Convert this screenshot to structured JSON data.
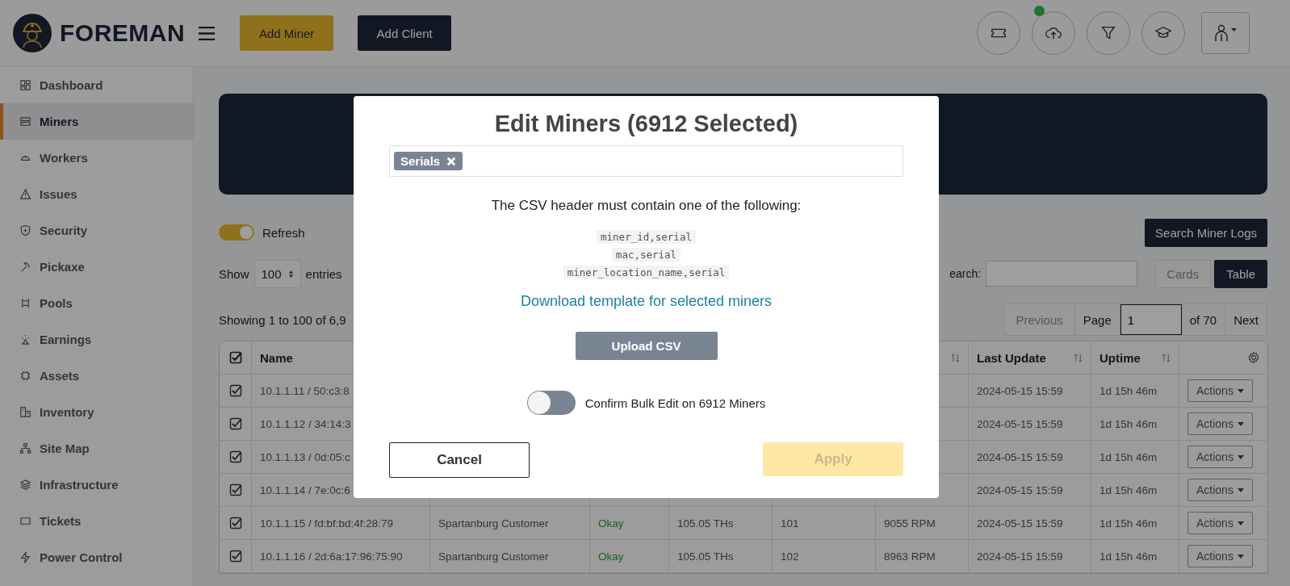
{
  "header": {
    "logo_text": "FOREMAN",
    "buttons": [
      {
        "label": "Add Miner",
        "kind": "accent"
      },
      {
        "label": "Add Client",
        "kind": "dark"
      }
    ],
    "notification": true
  },
  "sidebar": {
    "items": [
      {
        "label": "Dashboard",
        "selected": false
      },
      {
        "label": "Miners",
        "selected": true
      },
      {
        "label": "Workers",
        "selected": false
      },
      {
        "label": "Issues",
        "selected": false
      },
      {
        "label": "Security",
        "selected": false
      },
      {
        "label": "Pickaxe",
        "selected": false
      },
      {
        "label": "Pools",
        "selected": false
      },
      {
        "label": "Earnings",
        "selected": false
      },
      {
        "label": "Assets",
        "selected": false
      },
      {
        "label": "Inventory",
        "selected": false
      },
      {
        "label": "Site Map",
        "selected": false
      },
      {
        "label": "Infrastructure",
        "selected": false
      },
      {
        "label": "Tickets",
        "selected": false
      },
      {
        "label": "Power Control",
        "selected": false
      }
    ]
  },
  "content": {
    "refresh": {
      "label": "Refresh",
      "on": true
    },
    "search_logs_button": "Search Miner Logs",
    "length": {
      "label_before": "Show",
      "value": "100",
      "label_after": "entries"
    },
    "search": {
      "label": "earch:"
    },
    "views": [
      {
        "label": "Cards",
        "selected": false
      },
      {
        "label": "Table",
        "selected": true
      }
    ],
    "info": "Showing 1 to 100 of 6,9",
    "pagination": {
      "previous": "Previous",
      "page_label": "Page",
      "page_value": "1",
      "of": "of 70",
      "next": "Next"
    },
    "table": {
      "all_checked": true,
      "columns": [
        {
          "kind": "text",
          "label": "Name"
        },
        {
          "kind": "text"
        },
        {
          "kind": "status"
        },
        {
          "kind": "text"
        },
        {
          "kind": "text"
        },
        {
          "kind": "text",
          "sortable": true
        },
        {
          "kind": "text",
          "label": "Last Update",
          "sortable": true
        },
        {
          "kind": "text",
          "label": "Uptime",
          "sortable": true
        },
        {
          "kind": "actions"
        }
      ],
      "rows": [
        {
          "checked": true,
          "cells": [
            "10.1.1.11 / 50:c3:8",
            null,
            null,
            null,
            null,
            null,
            "2024-05-15 15:59",
            "1d 15h 46m",
            "Actions"
          ]
        },
        {
          "checked": true,
          "cells": [
            "10.1.1.12 / 34:14:3",
            null,
            null,
            null,
            null,
            null,
            "2024-05-15 15:59",
            "1d 15h 46m",
            "Actions"
          ]
        },
        {
          "checked": true,
          "cells": [
            "10.1.1.13 / 0d:05:c",
            null,
            null,
            null,
            null,
            null,
            "2024-05-15 15:59",
            "1d 15h 46m",
            "Actions"
          ]
        },
        {
          "checked": true,
          "cells": [
            "10.1.1.14 / 7e:0c:6",
            null,
            null,
            null,
            null,
            null,
            "2024-05-15 15:59",
            "1d 15h 46m",
            "Actions"
          ]
        },
        {
          "checked": true,
          "cells": [
            "10.1.1.15 / fd:bf:bd:4f:28:79",
            "Spartanburg Customer",
            "Okay",
            "105.05 THs",
            "101",
            "9055 RPM",
            "2024-05-15 15:59",
            "1d 15h 46m",
            "Actions"
          ]
        },
        {
          "checked": true,
          "cells": [
            "10.1.1.16 / 2d:6a:17:96:75:90",
            "Spartanburg Customer",
            "Okay",
            "105.05 THs",
            "102",
            "8963 RPM",
            "2024-05-15 15:59",
            "1d 15h 46m",
            "Actions"
          ]
        }
      ]
    }
  },
  "modal": {
    "title": "Edit Miners (6912 Selected)",
    "tags": [
      "Serials"
    ],
    "instruction": "The CSV header must contain one of the following:",
    "headers": [
      "miner_id,serial",
      "mac,serial",
      "miner_location_name,serial"
    ],
    "download_link": "Download template for selected miners",
    "upload_button": "Upload CSV",
    "confirm": {
      "label": "Confirm Bulk Edit on 6912 Miners",
      "on": false
    },
    "cancel_button": "Cancel",
    "apply_button": {
      "label": "Apply",
      "disabled": true
    }
  }
}
